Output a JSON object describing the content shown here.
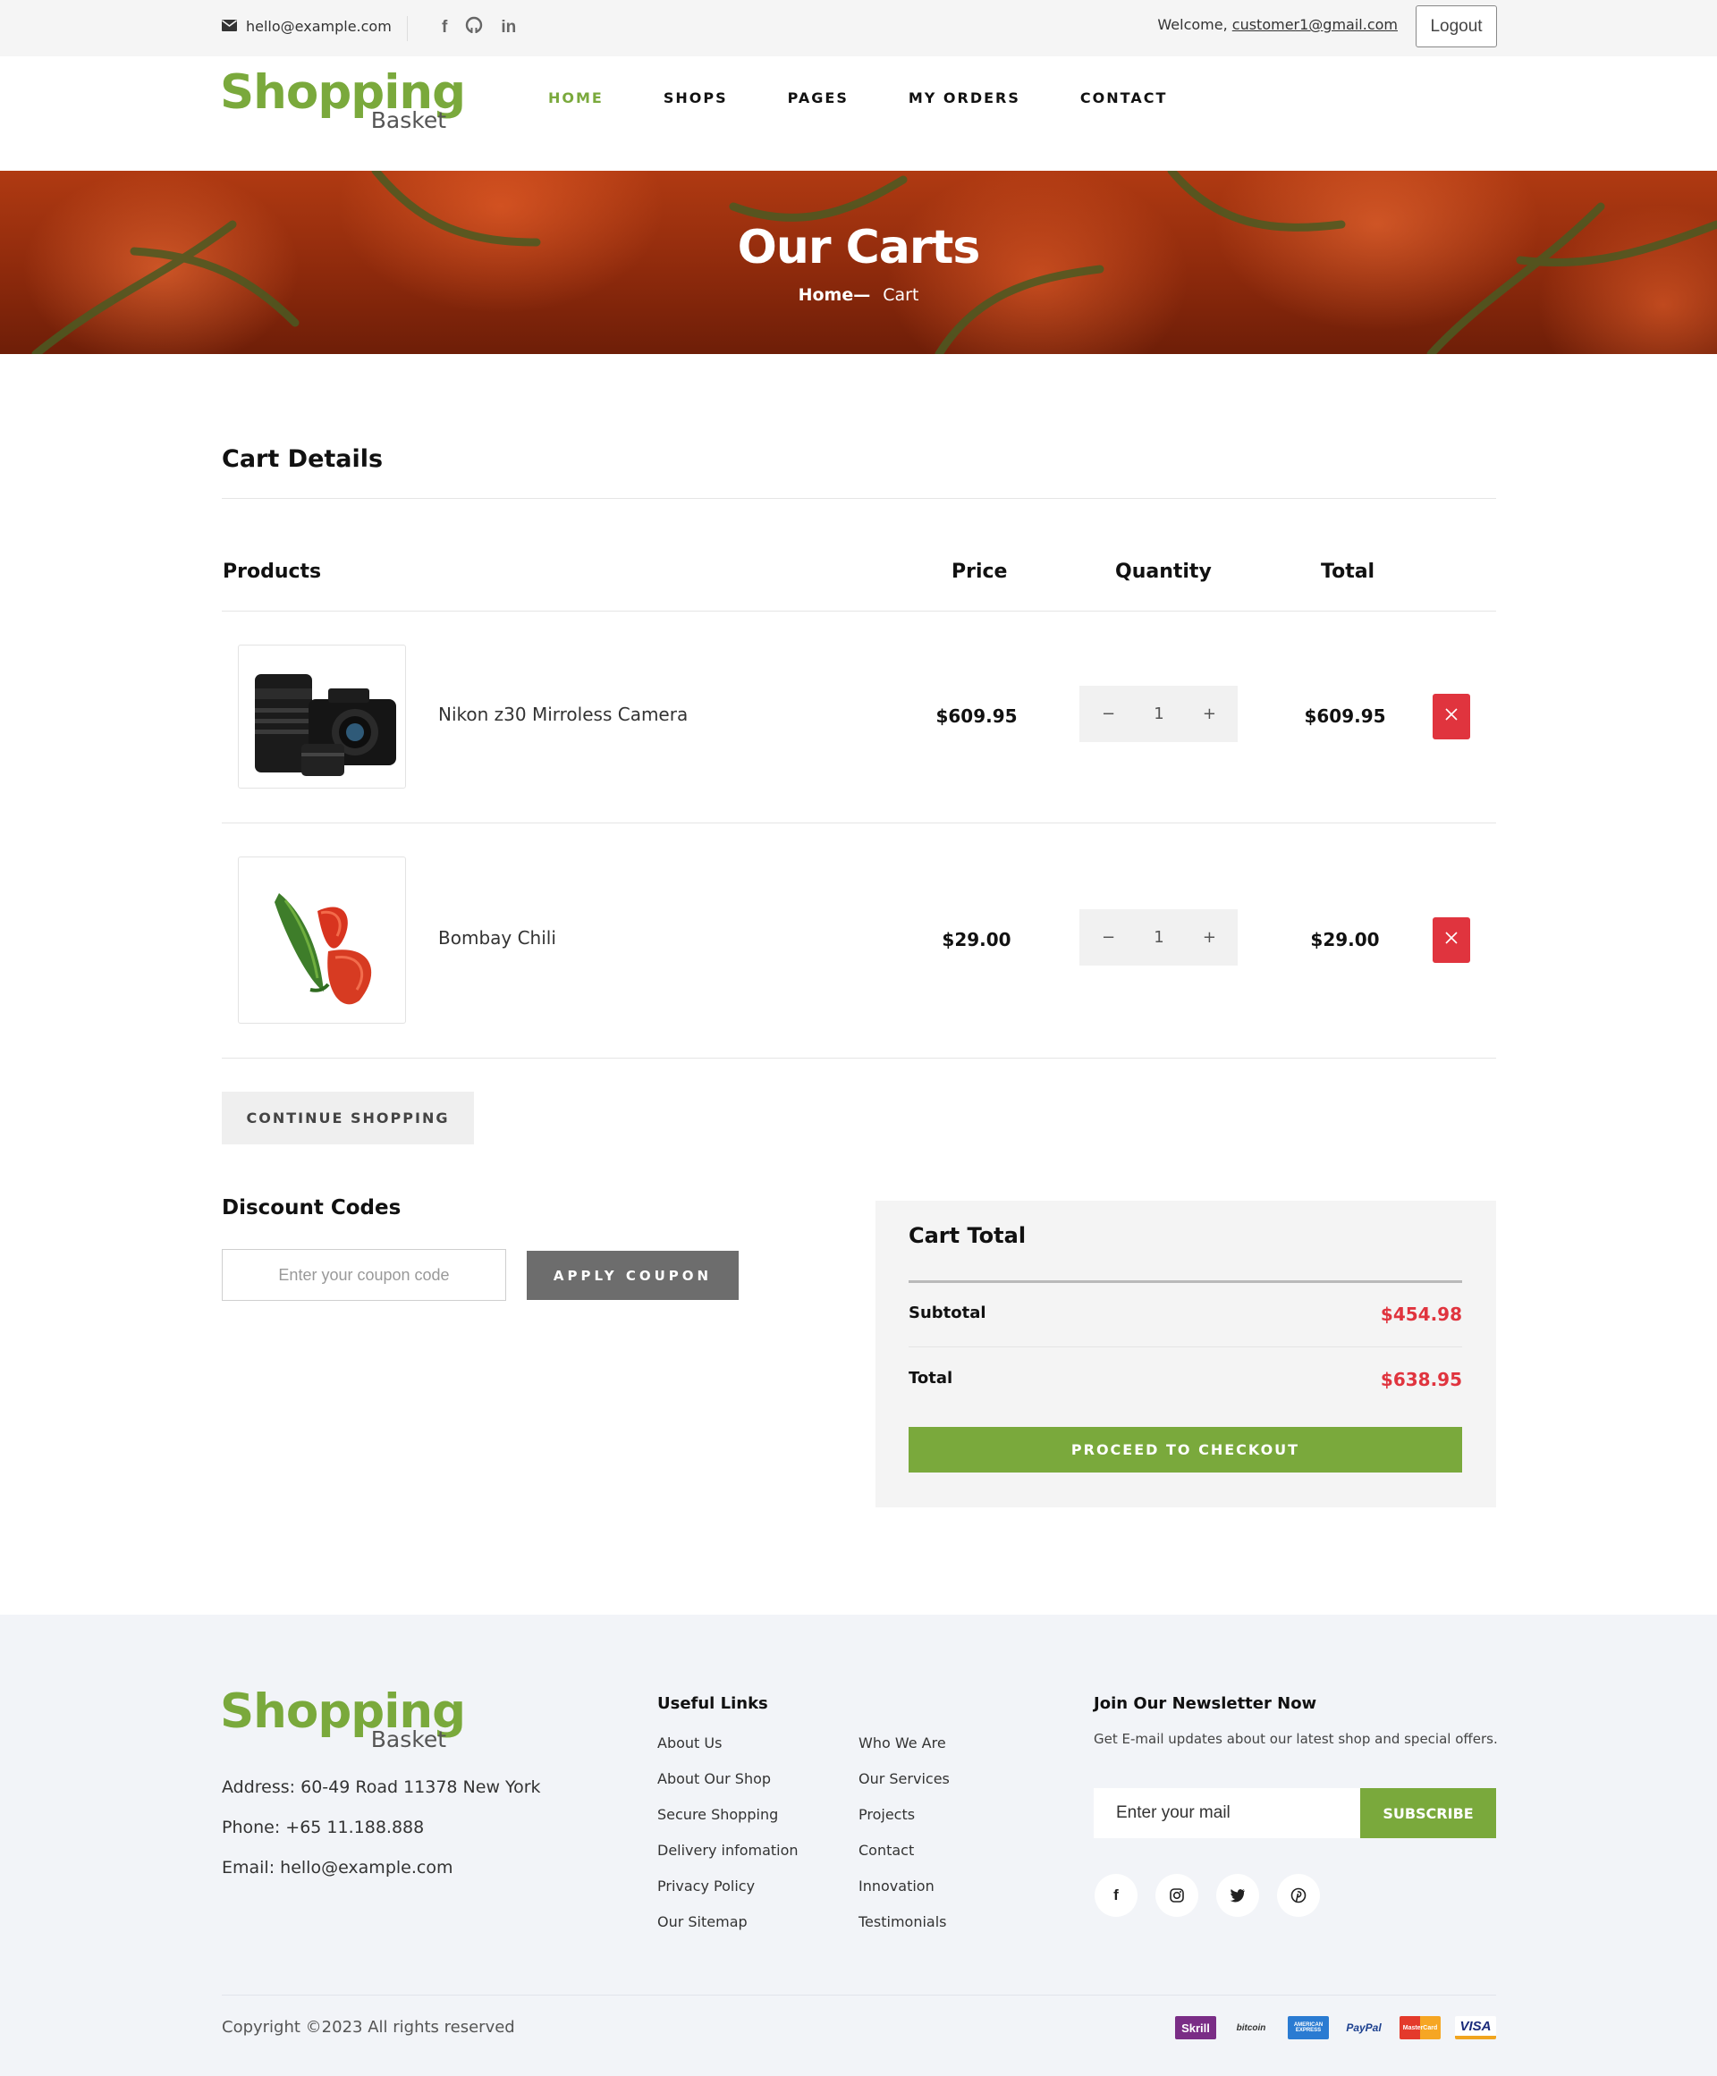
{
  "topbar": {
    "email": "hello@example.com",
    "social_icons": [
      "facebook-icon",
      "github-icon",
      "linkedin-icon"
    ],
    "welcome_prefix": "Welcome,",
    "user_email": "customer1@gmail.com",
    "logout_label": "Logout"
  },
  "brand": {
    "line1": "Shopping",
    "line2": "Basket",
    "color": "#7aa93c"
  },
  "nav": {
    "items": [
      {
        "label": "HOME",
        "active": true
      },
      {
        "label": "SHOPS",
        "active": false
      },
      {
        "label": "PAGES",
        "active": false
      },
      {
        "label": "MY ORDERS",
        "active": false
      },
      {
        "label": "CONTACT",
        "active": false
      }
    ]
  },
  "banner": {
    "title": "Our Carts",
    "crumb_home": "Home—",
    "crumb_current": "Cart"
  },
  "cart": {
    "title": "Cart Details",
    "headers": {
      "products": "Products",
      "price": "Price",
      "quantity": "Quantity",
      "total": "Total"
    },
    "items": [
      {
        "name": "Nikon z30 Mirroless Camera",
        "price": "$609.95",
        "qty": "1",
        "total": "$609.95",
        "image": "camera"
      },
      {
        "name": "Bombay Chili",
        "price": "$29.00",
        "qty": "1",
        "total": "$29.00",
        "image": "chili"
      }
    ],
    "qty_minus": "−",
    "qty_plus": "+",
    "continue_label": "CONTINUE SHOPPING"
  },
  "discount": {
    "title": "Discount Codes",
    "placeholder": "Enter your coupon code",
    "apply_label": "APPLY COUPON"
  },
  "cart_total": {
    "title": "Cart Total",
    "subtotal_label": "Subtotal",
    "subtotal_value": "$454.98",
    "total_label": "Total",
    "total_value": "$638.95",
    "checkout_label": "PROCEED TO CHECKOUT",
    "accent": "#e0343e"
  },
  "footer": {
    "address": "Address: 60-49 Road 11378 New York",
    "phone": "Phone: +65 11.188.888",
    "email": "Email: hello@example.com",
    "useful_links_title": "Useful Links",
    "links_col1": [
      "About Us",
      "About Our Shop",
      "Secure Shopping",
      "Delivery infomation",
      "Privacy Policy",
      "Our Sitemap"
    ],
    "links_col2": [
      "Who We Are",
      "Our Services",
      "Projects",
      "Contact",
      "Innovation",
      "Testimonials"
    ],
    "newsletter_title": "Join Our Newsletter Now",
    "newsletter_text": "Get E-mail updates about our latest shop and special offers.",
    "newsletter_placeholder": "Enter your mail",
    "subscribe_label": "SUBSCRIBE",
    "social_icons": [
      "facebook-icon",
      "instagram-icon",
      "twitter-icon",
      "pinterest-icon"
    ],
    "copyright": "Copyright ©2023 All rights reserved",
    "payments": [
      "Skrill",
      "bitcoin",
      "AMERICAN EXPRESS",
      "PayPal",
      "MasterCard",
      "VISA"
    ]
  }
}
